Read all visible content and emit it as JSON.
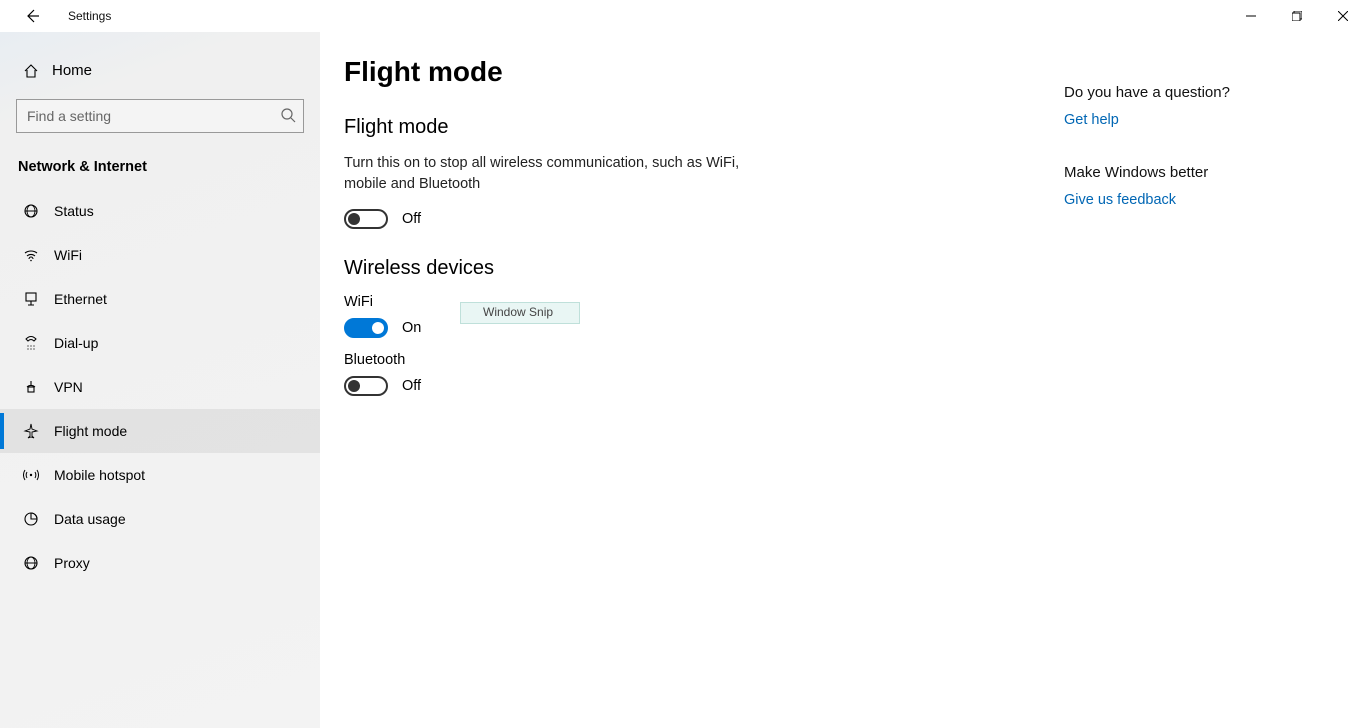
{
  "window": {
    "title": "Settings"
  },
  "sidebar": {
    "home": "Home",
    "search_placeholder": "Find a setting",
    "category": "Network & Internet",
    "items": [
      {
        "label": "Status"
      },
      {
        "label": "WiFi"
      },
      {
        "label": "Ethernet"
      },
      {
        "label": "Dial-up"
      },
      {
        "label": "VPN"
      },
      {
        "label": "Flight mode"
      },
      {
        "label": "Mobile hotspot"
      },
      {
        "label": "Data usage"
      },
      {
        "label": "Proxy"
      }
    ],
    "selected_index": 5
  },
  "page": {
    "title": "Flight mode",
    "flight_mode": {
      "heading": "Flight mode",
      "description": "Turn this on to stop all wireless communication, such as WiFi, mobile and Bluetooth",
      "state": "Off",
      "on": false
    },
    "wireless_devices": {
      "heading": "Wireless devices",
      "wifi": {
        "label": "WiFi",
        "state": "On",
        "on": true
      },
      "bluetooth": {
        "label": "Bluetooth",
        "state": "Off",
        "on": false
      }
    }
  },
  "tooltip": {
    "text": "Window Snip"
  },
  "right": {
    "question_heading": "Do you have a question?",
    "help_link": "Get help",
    "feedback_heading": "Make Windows better",
    "feedback_link": "Give us feedback"
  }
}
